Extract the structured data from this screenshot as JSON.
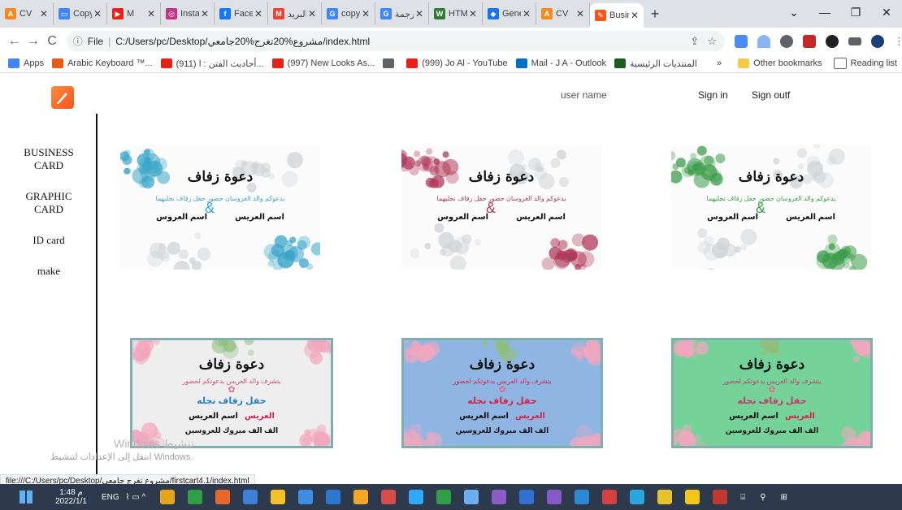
{
  "browser": {
    "tabs": [
      {
        "title": "CV",
        "icon_color": "#f28b24",
        "icon_char": "A"
      },
      {
        "title": "Copy",
        "icon_color": "#4285f4",
        "icon_char": "▭"
      },
      {
        "title": "M",
        "icon_color": "#e62117",
        "icon_char": "▶"
      },
      {
        "title": "Insta",
        "icon_color": "#c13584",
        "icon_char": "◎"
      },
      {
        "title": "Faceb",
        "icon_color": "#1877f2",
        "icon_char": "f"
      },
      {
        "title": "البريد",
        "icon_color": "#ea4335",
        "icon_char": "M"
      },
      {
        "title": "copy",
        "icon_color": "#4285f4",
        "icon_char": "G"
      },
      {
        "title": "ترجمة",
        "icon_color": "#4285f4",
        "icon_char": "G"
      },
      {
        "title": "HTML",
        "icon_color": "#2e7d32",
        "icon_char": "W"
      },
      {
        "title": "Gene",
        "icon_color": "#1a73e8",
        "icon_char": "◆"
      },
      {
        "title": "CV",
        "icon_color": "#f28b24",
        "icon_char": "A"
      }
    ],
    "active_tab": {
      "title": "Busin",
      "icon_color": "#f2561d",
      "icon_char": "✎"
    },
    "address": {
      "scheme": "File",
      "url": "C:/Users/pc/Desktop/مشروع%20تغرج%20جامعي/index.html"
    },
    "bookmarks": [
      {
        "label": "Apps",
        "color": "#4285f4"
      },
      {
        "label": "Arabic Keyboard ™...",
        "color": "#e8591a"
      },
      {
        "label": "(911) أحاديث الفتن : ا...",
        "color": "#e62117"
      },
      {
        "label": "(997) New Looks As...",
        "color": "#e62117"
      },
      {
        "label": "",
        "color": "#5f6368"
      },
      {
        "label": "(999) Jo Al - YouTube",
        "color": "#e62117"
      },
      {
        "label": "Mail - J A - Outlook",
        "color": "#0072c6"
      },
      {
        "label": "المنتديات الرئيسية",
        "color": "#1b5e20"
      }
    ],
    "bookmarks_right": {
      "overflow": "»",
      "other": "Other bookmarks",
      "reading": "Reading list"
    }
  },
  "page": {
    "header": {
      "username": "user name",
      "signin": "Sign in",
      "signout": "Sign outf"
    },
    "sidebar": [
      {
        "line1": "BUSINESS",
        "line2": "CARD"
      },
      {
        "line1": "GRAPHIC",
        "line2": "CARD"
      },
      {
        "line1": "ID card",
        "line2": ""
      },
      {
        "line1": "make",
        "line2": ""
      }
    ],
    "cards_row1": [
      {
        "theme": "blue",
        "flower": "#3aa6c9",
        "title": "دعوة زفاف",
        "verse": "يدعوكم والد العروسان حضور حفل زفاف نجليهما",
        "bride": "اسم العروس",
        "groom": "اسم العريس"
      },
      {
        "theme": "red",
        "flower": "#b03a5b",
        "title": "دعوة زفاف",
        "verse": "يدعوكم والد العروسان حضور حفل زفاف نجليهما",
        "bride": "اسم العروس",
        "groom": "اسم العريس"
      },
      {
        "theme": "green",
        "flower": "#3c9d4a",
        "title": "دعوة زفاف",
        "verse": "يدعوكم والد العروسان حضور حفل زفاف نجليهما",
        "bride": "اسم العروس",
        "groom": "اسم العريس"
      }
    ],
    "cards_row2": [
      {
        "bg": "#eeeeee",
        "border": "#7fb0b0",
        "verse_color": "#d44a7a",
        "sub_color": "#2b7fbf",
        "title": "دعوة زفاف",
        "verse": "يتشرف والد العريس بدعوتكم لحضور",
        "sub": "حفل زفاف نجله",
        "groom": "العريس",
        "name": "اسم العريس",
        "wish": "الف الف مبروك للعروسين"
      },
      {
        "bg": "#8fb6e3",
        "border": "#7fb0b0",
        "verse_color": "#d4224a",
        "sub_color": "#d4224a",
        "title": "دعوة زفاف",
        "verse": "يتشرف والد العريس بدعوتكم لحضور",
        "sub": "حفل زفاف نجله",
        "groom": "العريس",
        "name": "اسم العريس",
        "wish": "الف الف مبروك للعروسين"
      },
      {
        "bg": "#75d39a",
        "border": "#7fb0b0",
        "verse_color": "#c23b6a",
        "sub_color": "#c23b6a",
        "title": "دعوة زفاف",
        "verse": "يتشرف والد العريس بدعوتكم لحضور",
        "sub": "حفل زفاف نجله",
        "groom": "العريس",
        "name": "اسم العريس",
        "wish": "الف الف مبروك للعروسين"
      }
    ],
    "watermark": {
      "line1": "Windows تنشيط",
      "line2": "انتقل إلى الإعدادات لتنشيط Windows."
    },
    "status_url": "file:///C:/Users/pc/Desktop/مشروع تغرج جامعي/firstcart4.1/index.html"
  },
  "taskbar": {
    "lang": "ENG",
    "time": "1:48 م",
    "date": "2022/1/1",
    "apps": [
      "#e8a41a",
      "#2ea043",
      "#e6682c",
      "#3c7fd8",
      "#f6c026",
      "#3a8ee6",
      "#2b78d0",
      "#f5a623",
      "#d94a4a",
      "#31a8ff",
      "#2ea043",
      "#6ab0f0",
      "#8a5cc9",
      "#2f6fd6",
      "#8659c9",
      "#2b8ad6",
      "#d84040",
      "#2aa6df",
      "#e8c22a",
      "#f5c518",
      "#c0392b"
    ]
  }
}
